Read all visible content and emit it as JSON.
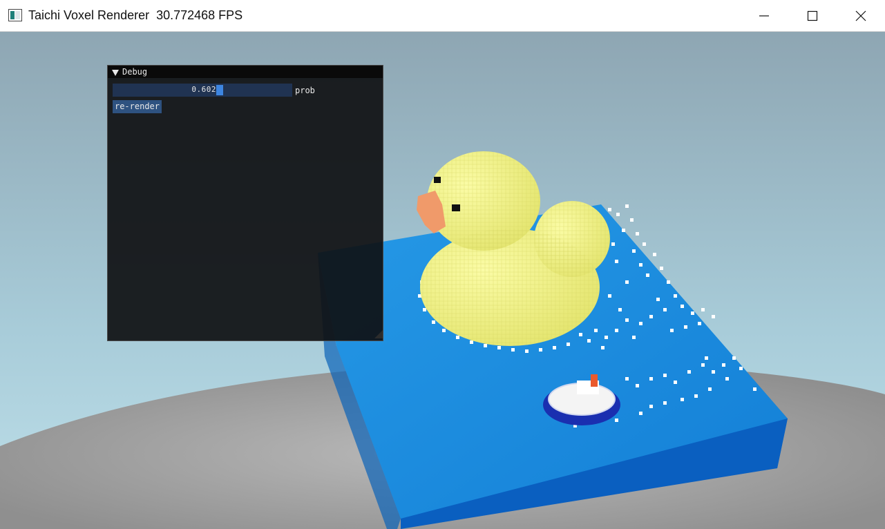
{
  "window": {
    "title": "Taichi Voxel Renderer  30.772468 FPS",
    "controls": {
      "minimize": "minimize-icon",
      "maximize": "maximize-icon",
      "close": "close-icon"
    }
  },
  "debug_panel": {
    "title": "Debug",
    "slider": {
      "value": "0.602",
      "label": "prob",
      "fraction": 0.602
    },
    "rerender_label": "re-render"
  },
  "scene": {
    "background_top": "#8ea6b3",
    "background_bottom": "#b7dbe6",
    "floor": "#a3a3a3",
    "water_top": "#1d8fde",
    "water_side": "#0b6fcf",
    "duck": "#eef085",
    "beak": "#f09a6a",
    "boat_hull": "#1a2fb0",
    "boat_deck": "#f4f4f4",
    "boat_chimney": "#ea5a2d",
    "foam": "#ffffff"
  }
}
